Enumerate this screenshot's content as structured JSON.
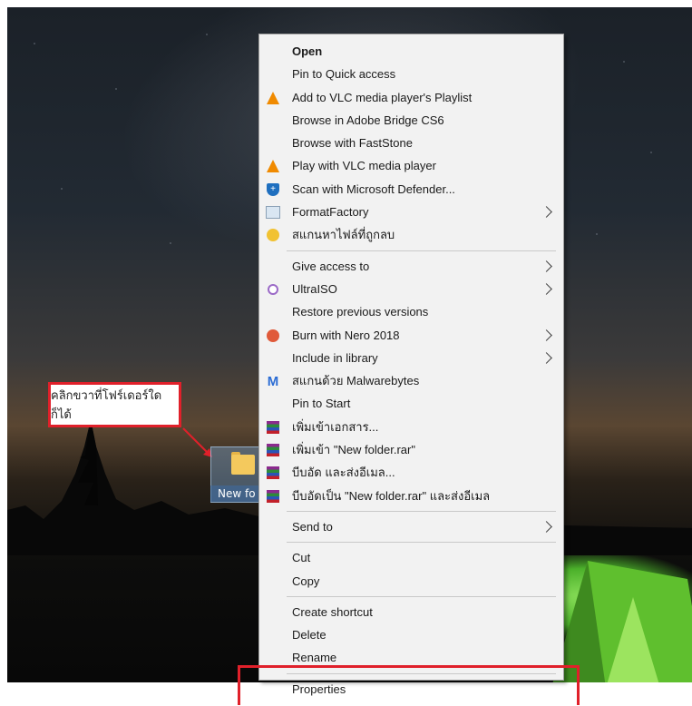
{
  "callout": {
    "text": "คลิกขวาที่โฟร์เดอร์ใดก็ได้"
  },
  "folder": {
    "label": "New fo"
  },
  "menu": {
    "items": [
      {
        "label": "Open",
        "bold": true,
        "icon": "",
        "submenu": false
      },
      {
        "label": "Pin to Quick access",
        "icon": "",
        "submenu": false
      },
      {
        "label": "Add to VLC media player's Playlist",
        "icon": "vlc-cone-icon",
        "submenu": false
      },
      {
        "label": "Browse in Adobe Bridge CS6",
        "icon": "",
        "submenu": false
      },
      {
        "label": "Browse with FastStone",
        "icon": "",
        "submenu": false
      },
      {
        "label": "Play with VLC media player",
        "icon": "vlc-cone-icon",
        "submenu": false
      },
      {
        "label": "Scan with Microsoft Defender...",
        "icon": "defender-shield-icon",
        "submenu": false
      },
      {
        "label": "FormatFactory",
        "icon": "formatfactory-icon",
        "submenu": true
      },
      {
        "label": "สแกนหาไฟล์ที่ถูกลบ",
        "icon": "file-recovery-icon",
        "submenu": false
      },
      {
        "label": "Give access to",
        "icon": "",
        "submenu": true
      },
      {
        "label": "UltraISO",
        "icon": "ultraiso-icon",
        "submenu": true
      },
      {
        "label": "Restore previous versions",
        "icon": "",
        "submenu": false
      },
      {
        "label": "Burn with Nero 2018",
        "icon": "nero-icon",
        "submenu": true
      },
      {
        "label": "Include in library",
        "icon": "",
        "submenu": true
      },
      {
        "label": "สแกนด้วย Malwarebytes",
        "icon": "malwarebytes-icon",
        "submenu": false
      },
      {
        "label": "Pin to Start",
        "icon": "",
        "submenu": false
      },
      {
        "label": "เพิ่มเข้าเอกสาร...",
        "icon": "winrar-icon",
        "submenu": false
      },
      {
        "label": "เพิ่มเข้า \"New folder.rar\"",
        "icon": "winrar-icon",
        "submenu": false
      },
      {
        "label": "บีบอัด และส่งอีเมล...",
        "icon": "winrar-icon",
        "submenu": false
      },
      {
        "label": "บีบอัดเป็น \"New folder.rar\" และส่งอีเมล",
        "icon": "winrar-icon",
        "submenu": false
      },
      {
        "label": "Send to",
        "icon": "",
        "submenu": true
      },
      {
        "label": "Cut",
        "icon": "",
        "submenu": false
      },
      {
        "label": "Copy",
        "icon": "",
        "submenu": false
      },
      {
        "label": "Create shortcut",
        "icon": "",
        "submenu": false
      },
      {
        "label": "Delete",
        "icon": "",
        "submenu": false
      },
      {
        "label": "Rename",
        "icon": "",
        "submenu": false
      },
      {
        "label": "Properties",
        "icon": "",
        "submenu": false
      }
    ]
  },
  "colors": {
    "highlight": "#e0202a",
    "menu_bg": "#f2f2f2"
  }
}
